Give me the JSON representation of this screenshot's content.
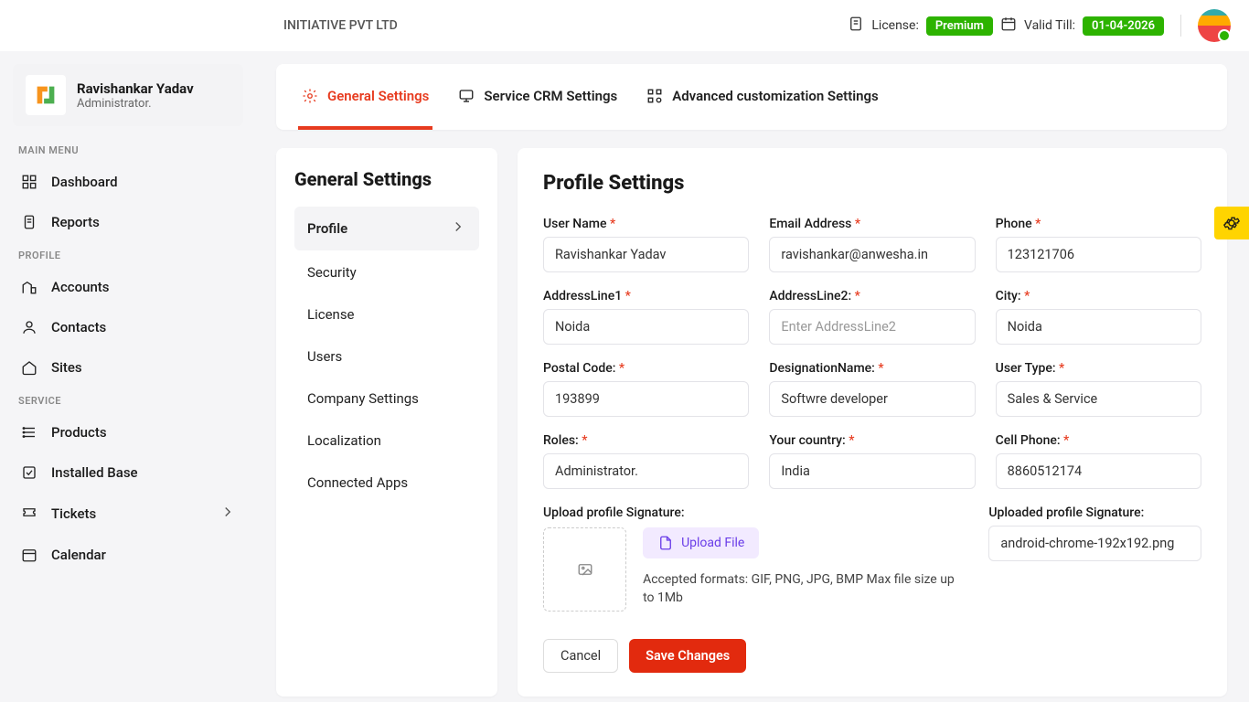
{
  "header": {
    "company": "INITIATIVE PVT LTD",
    "license_label": "License:",
    "license_value": "Premium",
    "valid_label": "Valid Till:",
    "valid_value": "01-04-2026"
  },
  "sidebar": {
    "user_name": "Ravishankar Yadav",
    "user_role": "Administrator.",
    "sections": {
      "main_menu": "MAIN MENU",
      "profile": "PROFILE",
      "service": "SERVICE"
    },
    "items": {
      "dashboard": "Dashboard",
      "reports": "Reports",
      "accounts": "Accounts",
      "contacts": "Contacts",
      "sites": "Sites",
      "products": "Products",
      "installed_base": "Installed Base",
      "tickets": "Tickets",
      "calendar": "Calendar"
    }
  },
  "tabs": {
    "general": "General Settings",
    "crm": "Service CRM Settings",
    "advanced": "Advanced customization Settings"
  },
  "settings_nav": {
    "title": "General Settings",
    "items": {
      "profile": "Profile",
      "security": "Security",
      "license": "License",
      "users": "Users",
      "company": "Company Settings",
      "localization": "Localization",
      "connected_apps": "Connected Apps"
    }
  },
  "form": {
    "title": "Profile Settings",
    "fields": {
      "user_name": {
        "label": "User Name",
        "value": "Ravishankar Yadav"
      },
      "email": {
        "label": "Email Address",
        "value": "ravishankar@anwesha.in"
      },
      "phone": {
        "label": "Phone",
        "value": "123121706"
      },
      "addr1": {
        "label": "AddressLine1",
        "value": "Noida"
      },
      "addr2": {
        "label": "AddressLine2:",
        "placeholder": "Enter AddressLine2"
      },
      "city": {
        "label": "City:",
        "value": "Noida"
      },
      "postal": {
        "label": "Postal Code:",
        "value": "193899"
      },
      "designation": {
        "label": "DesignationName:",
        "value": "Softwre developer"
      },
      "user_type": {
        "label": "User Type:",
        "value": "Sales & Service"
      },
      "roles": {
        "label": "Roles:",
        "value": "Administrator."
      },
      "country": {
        "label": "Your country:",
        "value": "India"
      },
      "cell": {
        "label": "Cell Phone:",
        "value": "8860512174"
      }
    },
    "upload": {
      "label": "Upload profile Signature:",
      "button": "Upload File",
      "accepted": "Accepted formats: GIF, PNG, JPG, BMP Max file size up to 1Mb",
      "uploaded_label": "Uploaded profile Signature:",
      "uploaded_value": "android-chrome-192x192.png"
    },
    "actions": {
      "cancel": "Cancel",
      "save": "Save Changes"
    }
  }
}
